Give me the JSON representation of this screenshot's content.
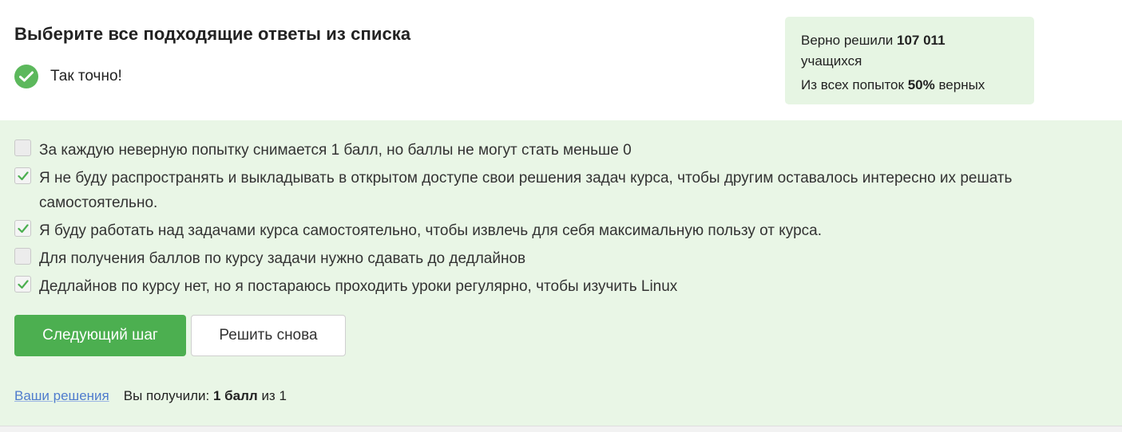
{
  "question": {
    "title": "Выберите все подходящие ответы из списка",
    "result_text": "Так точно!"
  },
  "stats": {
    "solved_prefix": "Верно решили",
    "solved_count": "107 011",
    "solved_suffix": "учащихся",
    "attempts_prefix": "Из всех попыток",
    "attempts_percent": "50%",
    "attempts_suffix": "верных"
  },
  "options": [
    {
      "label": "За каждую неверную попытку снимается 1 балл, но баллы не могут стать меньше 0",
      "checked": false
    },
    {
      "label": "Я не буду распространять и выкладывать в открытом доступе свои решения задач курса, чтобы другим оставалось интересно их решать самостоятельно.",
      "checked": true
    },
    {
      "label": "Я буду работать над задачами курса самостоятельно, чтобы извлечь для себя максимальную пользу от курса.",
      "checked": true
    },
    {
      "label": "Для получения баллов по курсу задачи нужно сдавать до дедлайнов",
      "checked": false
    },
    {
      "label": "Дедлайнов по курсу нет, но я постараюсь проходить уроки регулярно, чтобы изучить Linux",
      "checked": true
    }
  ],
  "buttons": {
    "next_label": "Следующий шаг",
    "retry_label": "Решить снова"
  },
  "footer": {
    "solutions_link": "Ваши решения",
    "score_prefix": "Вы получили:",
    "score_value": "1 балл",
    "score_suffix": "из 1"
  },
  "colors": {
    "accent_green": "#4caf50",
    "check_green": "#5cb85c",
    "answer_bg": "#e9f6e6",
    "link_blue": "#4f7ccd"
  }
}
